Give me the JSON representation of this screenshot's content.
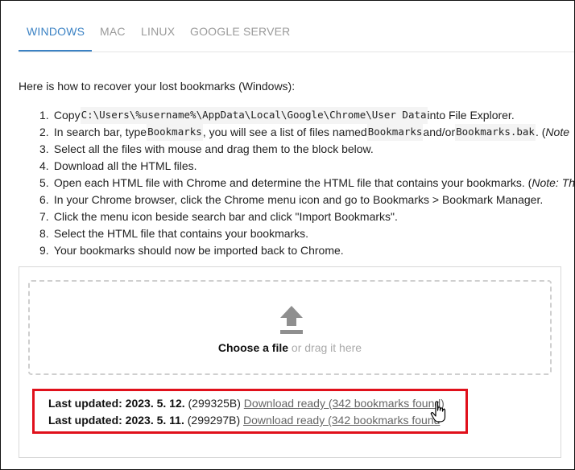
{
  "tabs": [
    {
      "label": "WINDOWS",
      "active": true
    },
    {
      "label": "MAC",
      "active": false
    },
    {
      "label": "LINUX",
      "active": false
    },
    {
      "label": "GOOGLE SERVER",
      "active": false
    }
  ],
  "intro": "Here is how to recover your lost bookmarks (Windows):",
  "steps": [
    {
      "num": "1.",
      "a": "Copy ",
      "code1": "C:\\Users\\%username%\\AppData\\Local\\Google\\Chrome\\User Data",
      "b": " into File Explorer."
    },
    {
      "num": "2.",
      "a": "In search bar, type ",
      "code1": "Bookmarks",
      "b": ", you will see a list of files named ",
      "code2": "Bookmarks",
      "c": " and/or ",
      "code3": "Bookmarks.bak",
      "d": ". (",
      "note": "Note"
    },
    {
      "num": "3.",
      "a": "Select all the files with mouse and drag them to the block below."
    },
    {
      "num": "4.",
      "a": "Download all the HTML files."
    },
    {
      "num": "5.",
      "a": "Open each HTML file with Chrome and determine the HTML file that contains your bookmarks. (",
      "note": "Note: The"
    },
    {
      "num": "6.",
      "a": "In your Chrome browser, click the Chrome menu icon and go to Bookmarks > Bookmark Manager."
    },
    {
      "num": "7.",
      "a": "Click the menu icon beside search bar and click \"Import Bookmarks\"."
    },
    {
      "num": "8.",
      "a": "Select the HTML file that contains your bookmarks."
    },
    {
      "num": "9.",
      "a": "Your bookmarks should now be imported back to Chrome."
    }
  ],
  "upload": {
    "icon": "upload-arrow-icon",
    "choose_label": "Choose a file",
    "drag_label": " or drag it here"
  },
  "updates": [
    {
      "label": "Last updated: 2023. 5. 12.",
      "size": " (299325B) ",
      "link": "Download ready (342 bookmarks found)"
    },
    {
      "label": "Last updated: 2023. 5. 11.",
      "size": " (299297B) ",
      "link": "Download ready (342 bookmarks found"
    }
  ],
  "colors": {
    "accent": "#3b82c4",
    "highlight": "#e0101b",
    "muted": "#9a9a9a"
  },
  "cursor": "hand-pointer-icon"
}
